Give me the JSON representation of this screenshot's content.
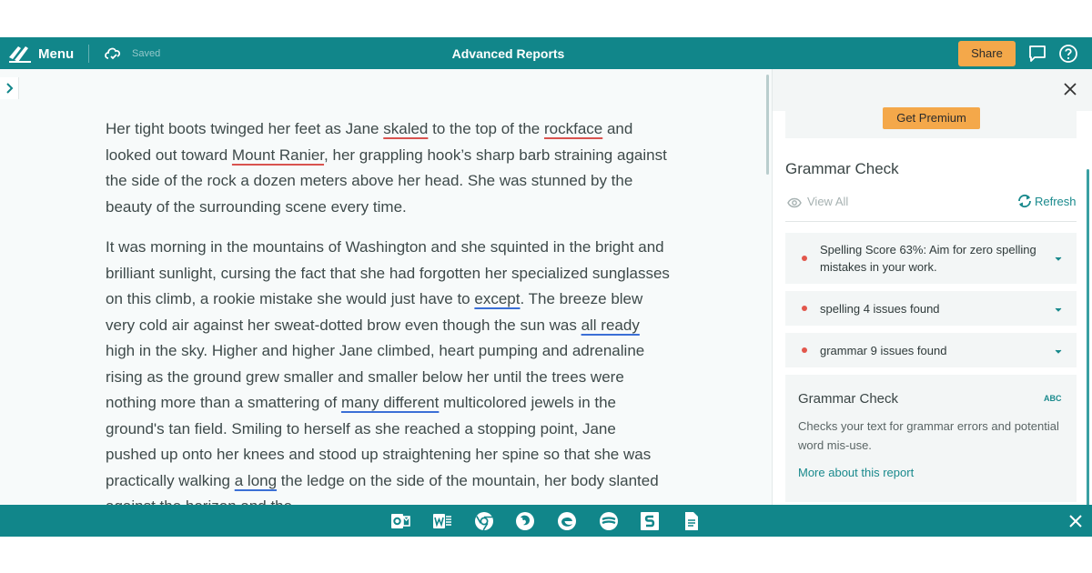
{
  "topbar": {
    "menu_label": "Menu",
    "saved_label": "Saved",
    "title": "Advanced Reports",
    "share_label": "Share"
  },
  "document": {
    "p1": [
      {
        "t": "Her tight boots twinged her feet as Jane "
      },
      {
        "t": "skaled",
        "k": "sp"
      },
      {
        "t": " to the top of the "
      },
      {
        "t": "rockface",
        "k": "sp"
      },
      {
        "t": " and looked out toward "
      },
      {
        "t": "Mount Ranier",
        "k": "sp"
      },
      {
        "t": ", her grappling hook’s sharp barb straining against the side of the rock a dozen meters above her head. She was stunned by the beauty of the surrounding scene every time."
      }
    ],
    "p2": [
      {
        "t": "It was morning in the mountains of Washington and she squinted in the bright and brilliant sunlight, cursing the fact that she had forgotten her specialized sunglasses on this climb, a rookie mistake she would just have to "
      },
      {
        "t": "except",
        "k": "gr"
      },
      {
        "t": ". The breeze blew very cold air against her sweat-dotted brow even though the sun was "
      },
      {
        "t": "all ready",
        "k": "gr"
      },
      {
        "t": " high in the sky. Higher and higher Jane climbed, heart pumping and adrenaline rising as the ground grew smaller and smaller below her until the trees were nothing more than a smattering of "
      },
      {
        "t": "many different",
        "k": "gr"
      },
      {
        "t": " multicolored jewels in the ground's tan field. Smiling to herself as she reached a stopping point, Jane pushed up onto her knees and stood up straightening her spine so that she was practically walking "
      },
      {
        "t": "a long",
        "k": "gr"
      },
      {
        "t": " the ledge on the side of the mountain, her body slanted against  the horizon and the"
      }
    ]
  },
  "panel": {
    "premium_label": "Get Premium",
    "title": "Grammar Check",
    "view_all": "View All",
    "refresh": "Refresh",
    "items": [
      {
        "text": "Spelling Score 63%: Aim for zero spelling mistakes in your work."
      },
      {
        "text": "spelling 4 issues found"
      },
      {
        "text": "grammar 9 issues found"
      }
    ],
    "info": {
      "heading": "Grammar Check",
      "abc": "ABC",
      "description": "Checks your text for grammar errors and potential word mis-use.",
      "link": "More about this report"
    }
  },
  "taskbar": {
    "icons": [
      "outlook-icon",
      "word-icon",
      "chrome-icon",
      "firefox-icon",
      "edge-icon",
      "safari-icon",
      "app-s-icon",
      "document-icon"
    ]
  },
  "colors": {
    "brand": "#11868a",
    "accent": "#f4a84a",
    "spelling_underline": "#d9534f",
    "grammar_underline": "#3b6fd6",
    "issue_dot": "#e2574c"
  }
}
